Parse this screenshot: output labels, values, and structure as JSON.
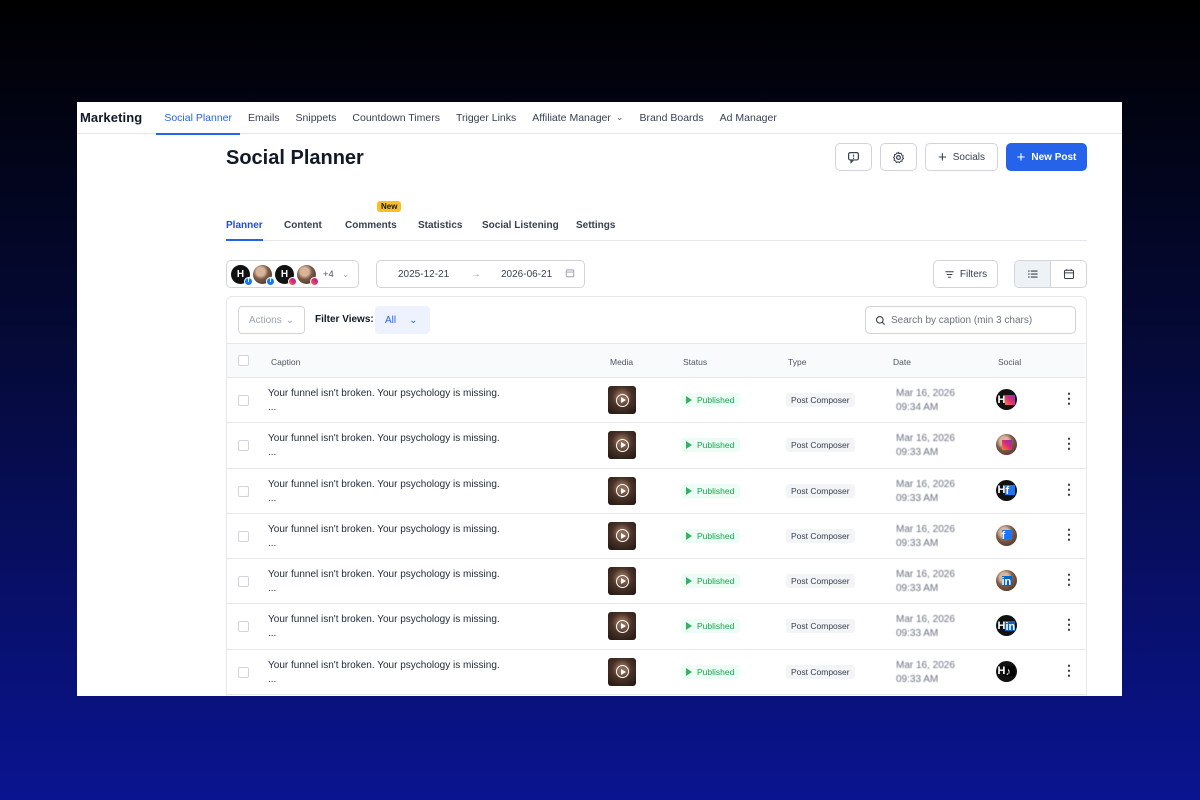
{
  "nav": {
    "brand": "Marketing",
    "items": [
      {
        "label": "Social Planner",
        "active": true
      },
      {
        "label": "Emails"
      },
      {
        "label": "Snippets"
      },
      {
        "label": "Countdown Timers"
      },
      {
        "label": "Trigger Links"
      },
      {
        "label": "Affiliate Manager",
        "dropdown": true
      },
      {
        "label": "Brand Boards"
      },
      {
        "label": "Ad Manager"
      }
    ]
  },
  "header": {
    "title": "Social Planner",
    "socials_label": "Socials",
    "new_post_label": "New Post"
  },
  "tabs": [
    {
      "label": "Planner",
      "active": true
    },
    {
      "label": "Content"
    },
    {
      "label": "Comments",
      "badge": "New"
    },
    {
      "label": "Statistics"
    },
    {
      "label": "Social Listening"
    },
    {
      "label": "Settings"
    }
  ],
  "toolbar": {
    "accounts_more": "+4",
    "date_start": "2025-12-21",
    "date_end": "2026-06-21",
    "filters_label": "Filters"
  },
  "table": {
    "actions_label": "Actions",
    "filter_views_label": "Filter Views:",
    "filter_views_value": "All",
    "search_placeholder": "Search by caption (min 3 chars)",
    "columns": [
      "Caption",
      "Media",
      "Status",
      "Type",
      "Date",
      "Social"
    ],
    "rows": [
      {
        "caption": "Your funnel isn't broken. Your psychology is missing.",
        "more": "...",
        "status": "Published",
        "type": "Post Composer",
        "date": "Mar 16, 2026",
        "time": "09:34 AM",
        "avatar": "h",
        "network": "ig"
      },
      {
        "caption": "Your funnel isn't broken. Your psychology is missing.",
        "more": "...",
        "status": "Published",
        "type": "Post Composer",
        "date": "Mar 16, 2026",
        "time": "09:33 AM",
        "avatar": "p",
        "network": "ig"
      },
      {
        "caption": "Your funnel isn't broken. Your psychology is missing.",
        "more": "...",
        "status": "Published",
        "type": "Post Composer",
        "date": "Mar 16, 2026",
        "time": "09:33 AM",
        "avatar": "h",
        "network": "fb"
      },
      {
        "caption": "Your funnel isn't broken. Your psychology is missing.",
        "more": "...",
        "status": "Published",
        "type": "Post Composer",
        "date": "Mar 16, 2026",
        "time": "09:33 AM",
        "avatar": "p",
        "network": "fb"
      },
      {
        "caption": "Your funnel isn't broken. Your psychology is missing.",
        "more": "...",
        "status": "Published",
        "type": "Post Composer",
        "date": "Mar 16, 2026",
        "time": "09:33 AM",
        "avatar": "p",
        "network": "li"
      },
      {
        "caption": "Your funnel isn't broken. Your psychology is missing.",
        "more": "...",
        "status": "Published",
        "type": "Post Composer",
        "date": "Mar 16, 2026",
        "time": "09:33 AM",
        "avatar": "h",
        "network": "li"
      },
      {
        "caption": "Your funnel isn't broken. Your psychology is missing.",
        "more": "...",
        "status": "Published",
        "type": "Post Composer",
        "date": "Mar 16, 2026",
        "time": "09:33 AM",
        "avatar": "h",
        "network": "tt"
      }
    ]
  },
  "colors": {
    "accent": "#2563eb",
    "published_green": "#16a34a",
    "new_badge": "#fbbf24"
  }
}
